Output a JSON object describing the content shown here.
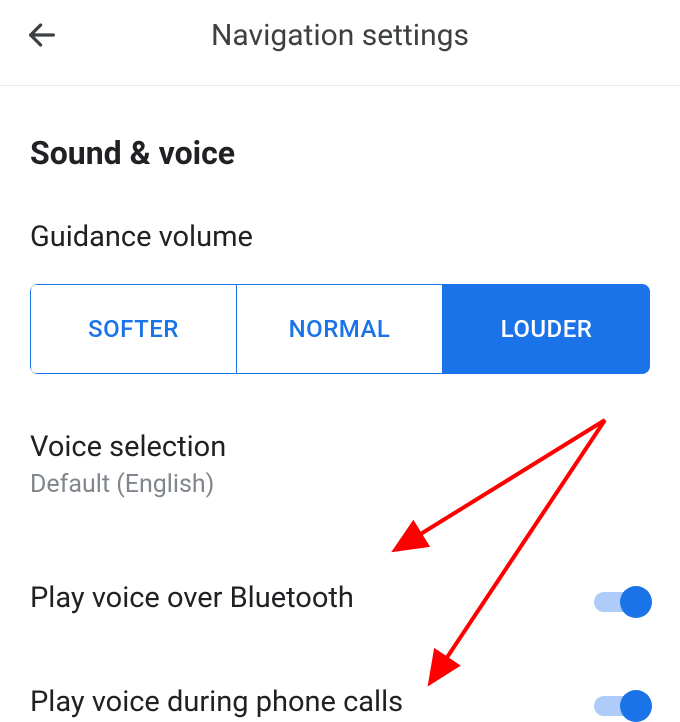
{
  "header": {
    "title": "Navigation settings"
  },
  "section": {
    "title": "Sound & voice"
  },
  "guidance_volume": {
    "label": "Guidance volume",
    "options": [
      "SOFTER",
      "NORMAL",
      "LOUDER"
    ],
    "selected": "LOUDER"
  },
  "voice_selection": {
    "label": "Voice selection",
    "value": "Default (English)"
  },
  "bluetooth": {
    "label": "Play voice over Bluetooth",
    "enabled": true
  },
  "phone_calls": {
    "label": "Play voice during phone calls",
    "enabled": true
  },
  "colors": {
    "accent": "#1a73e8",
    "accent_light": "#aecbfa",
    "annotation": "#ff0000"
  }
}
